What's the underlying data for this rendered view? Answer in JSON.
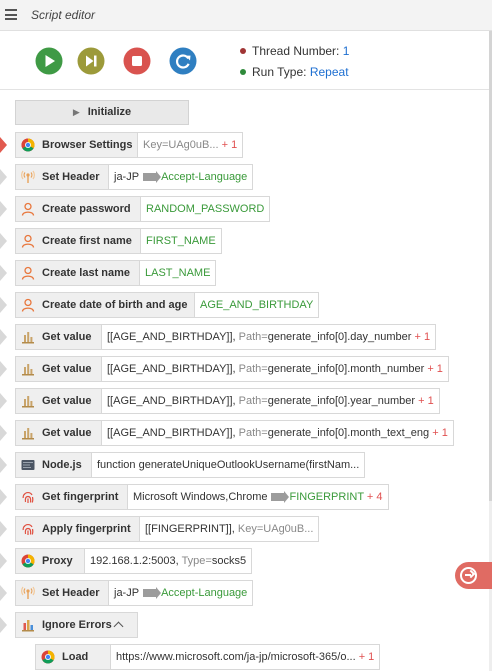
{
  "header": {
    "title": "Script editor"
  },
  "toolbar": {
    "thread_label": "Thread Number:",
    "thread_value": "1",
    "run_label": "Run Type:",
    "run_value": "Repeat",
    "colors": {
      "play": "#3f9a45",
      "step": "#9c9a3a",
      "stop": "#d9534f",
      "refresh": "#2f7fc1"
    }
  },
  "initialize_label": "Initialize",
  "steps": [
    {
      "label": "Browser Settings",
      "icon": "chrome-icon",
      "p1": "Key=UAg0uB...",
      "p2": "+ 1"
    },
    {
      "label": "Set Header",
      "icon": "antenna-icon",
      "p1": "ja-JP",
      "p2": "Accept-Language"
    },
    {
      "label": "Create password",
      "icon": "user-icon",
      "p1": "RANDOM_PASSWORD"
    },
    {
      "label": "Create first name",
      "icon": "user-icon",
      "p1": "FIRST_NAME"
    },
    {
      "label": "Create last name",
      "icon": "user-icon",
      "p1": "LAST_NAME"
    },
    {
      "label": "Create date of birth and age",
      "icon": "user-icon",
      "p1": "AGE_AND_BIRTHDAY"
    },
    {
      "label": "Get value",
      "icon": "stats-icon",
      "p1": "[[AGE_AND_BIRTHDAY]],",
      "p2": "Path=",
      "p3": "generate_info[0].day_number",
      "p4": "+ 1"
    },
    {
      "label": "Get value",
      "icon": "stats-icon",
      "p1": "[[AGE_AND_BIRTHDAY]],",
      "p2": "Path=",
      "p3": "generate_info[0].month_number",
      "p4": "+ 1"
    },
    {
      "label": "Get value",
      "icon": "stats-icon",
      "p1": "[[AGE_AND_BIRTHDAY]],",
      "p2": "Path=",
      "p3": "generate_info[0].year_number",
      "p4": "+ 1"
    },
    {
      "label": "Get value",
      "icon": "stats-icon",
      "p1": "[[AGE_AND_BIRTHDAY]],",
      "p2": "Path=",
      "p3": "generate_info[0].month_text_eng",
      "p4": "+ 1"
    },
    {
      "label": "Node.js",
      "icon": "nodejs-icon",
      "p1": "function generateUniqueOutlookUsername(firstNam..."
    },
    {
      "label": "Get fingerprint",
      "icon": "fingerprint-icon",
      "p1": "Microsoft Windows,Chrome",
      "p2": "FINGERPRINT",
      "p3": "+ 4"
    },
    {
      "label": "Apply fingerprint",
      "icon": "fingerprint-icon",
      "p1": "[[FINGERPRINT]],",
      "p2": "Key=UAg0uB..."
    },
    {
      "label": "Proxy",
      "icon": "chrome-icon",
      "p1": "192.168.1.2:5003,",
      "p2": "Type=",
      "p3": "socks5"
    },
    {
      "label": "Set Header",
      "icon": "antenna-icon",
      "p1": "ja-JP",
      "p2": "Accept-Language"
    },
    {
      "label": "Ignore Errors",
      "icon": "ignore-errors-icon"
    },
    {
      "label": "Load",
      "icon": "chrome-icon",
      "p1": "https://www.microsoft.com/ja-jp/microsoft-365/o...",
      "p2": "+ 1"
    }
  ]
}
